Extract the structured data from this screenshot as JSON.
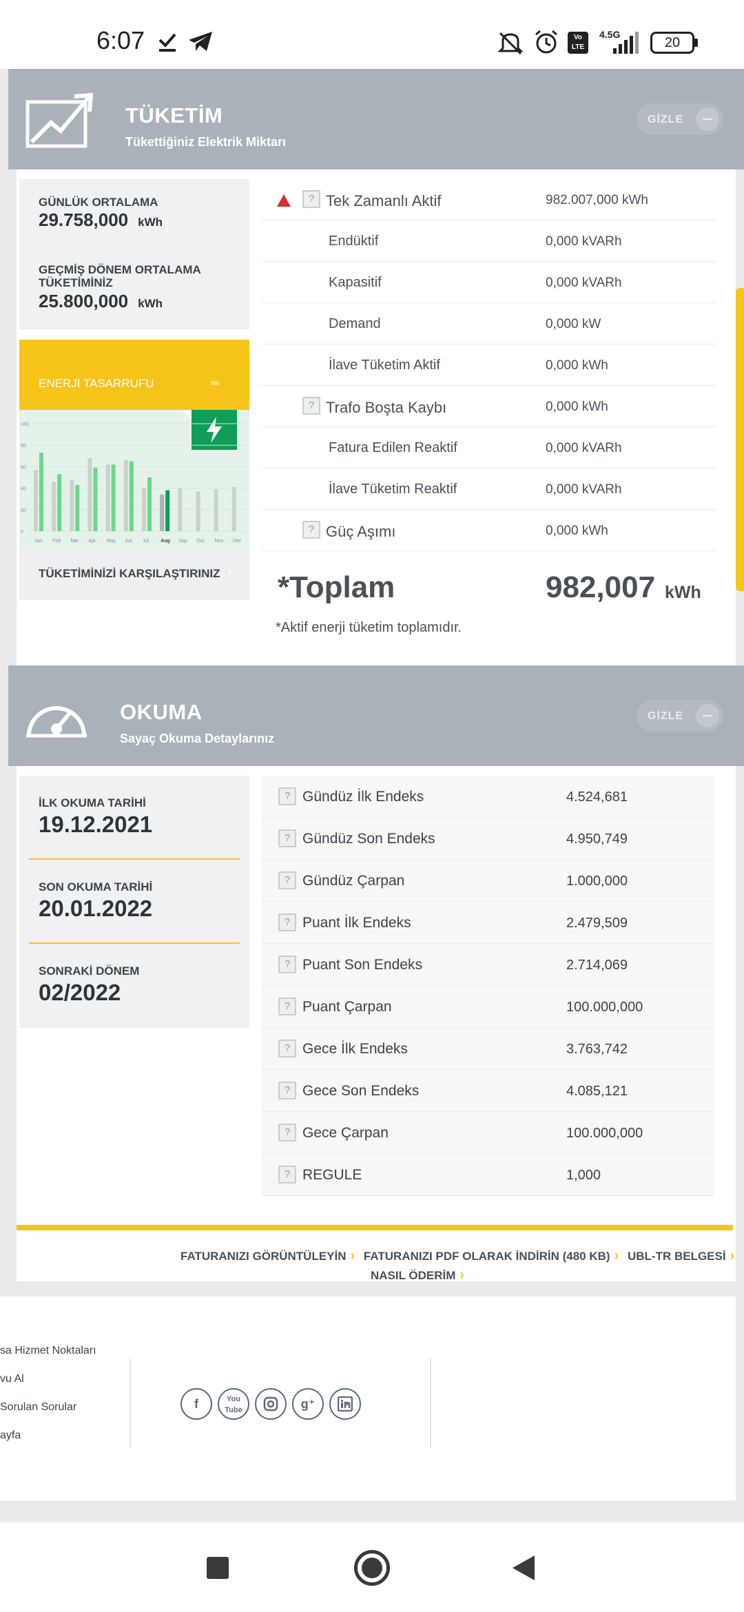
{
  "status_bar": {
    "time": "6:07",
    "network": "4.5G",
    "battery": "20"
  },
  "tuketim": {
    "title": "TÜKETİM",
    "subtitle": "Tükettiğiniz Elektrik Miktarı",
    "hide_label": "GİZLE",
    "daily_avg_label": "GÜNLÜK ORTALAMA",
    "daily_avg_value": "29.758,000",
    "daily_avg_unit": "kWh",
    "prev_avg_label": "GEÇMİŞ DÖNEM ORTALAMA TÜKETİMİNİZ",
    "prev_avg_value": "25.800,000",
    "prev_avg_unit": "kWh",
    "energy_saving": "ENERJİ TASARRUFU",
    "compare_label": "TÜKETİMİNİZİ KARŞILAŞTIRINIZ",
    "rows": [
      {
        "label": "Tek Zamanlı Aktif",
        "value": "982.007,000 kWh"
      },
      {
        "label": "Endüktif",
        "value": "0,000 kVARh"
      },
      {
        "label": "Kapasitif",
        "value": "0,000 kVARh"
      },
      {
        "label": "Demand",
        "value": "0,000 kW"
      },
      {
        "label": "İlave Tüketim Aktif",
        "value": "0,000 kWh"
      },
      {
        "label": "Trafo Boşta Kaybı",
        "value": "0,000 kWh"
      },
      {
        "label": "Fatura Edilen Reaktif",
        "value": "0,000 kVARh"
      },
      {
        "label": "İlave Tüketim Reaktif",
        "value": "0,000 kVARh"
      },
      {
        "label": "Güç Aşımı",
        "value": "0,000 kWh"
      }
    ],
    "total_label": "*Toplam",
    "total_value": "982,007",
    "total_unit": "kWh",
    "total_note": "*Aktif enerji tüketim toplamıdır.",
    "chart_data": {
      "type": "bar",
      "categories": [
        "Jan",
        "Feb",
        "Mar",
        "Apr",
        "May",
        "Jun",
        "Jul",
        "Aug",
        "Sep",
        "Oct",
        "Nov",
        "Dec"
      ],
      "y_ticks": [
        "100",
        "80",
        "60",
        "40",
        "20",
        "0"
      ],
      "ylim": [
        0,
        100
      ],
      "series": [
        {
          "values": [
            57,
            46,
            48,
            68,
            62,
            66,
            40,
            34,
            40,
            37,
            39,
            41
          ]
        },
        {
          "values": [
            73,
            53,
            43,
            59,
            62,
            65,
            50,
            38,
            null,
            null,
            null,
            null
          ]
        }
      ]
    }
  },
  "okuma": {
    "title": "OKUMA",
    "subtitle": "Sayaç Okuma Detaylarınız",
    "hide_label": "GİZLE",
    "first_read_label": "İLK OKUMA TARİHİ",
    "first_read_value": "19.12.2021",
    "last_read_label": "SON OKUMA TARİHİ",
    "last_read_value": "20.01.2022",
    "next_period_label": "SONRAKİ DÖNEM",
    "next_period_value": "02/2022",
    "rows": [
      {
        "label": "Gündüz İlk Endeks",
        "value": "4.524,681"
      },
      {
        "label": "Gündüz Son Endeks",
        "value": "4.950,749"
      },
      {
        "label": "Gündüz Çarpan",
        "value": "1.000,000"
      },
      {
        "label": "Puant İlk Endeks",
        "value": "2.479,509"
      },
      {
        "label": "Puant Son Endeks",
        "value": "2.714,069"
      },
      {
        "label": "Puant Çarpan",
        "value": "100.000,000"
      },
      {
        "label": "Gece İlk Endeks",
        "value": "3.763,742"
      },
      {
        "label": "Gece Son Endeks",
        "value": "4.085,121"
      },
      {
        "label": "Gece Çarpan",
        "value": "100.000,000"
      },
      {
        "label": "REGULE",
        "value": "1,000"
      }
    ]
  },
  "footer": {
    "link1": "FATURANIZI GÖRÜNTÜLEYİN",
    "link2": "FATURANIZI PDF OLARAK İNDİRİN (480 KB)",
    "link3": "UBL-TR BELGESİ",
    "link4": "NASIL ÖDERİM",
    "menu": [
      "sa Hizmet Noktaları",
      "vu Al",
      "Sorulan Sorular",
      "ayfa"
    ]
  },
  "colors": {
    "accent": "#f6c319",
    "header_bg": "#a9b2b9",
    "green": "#0f9d58"
  }
}
